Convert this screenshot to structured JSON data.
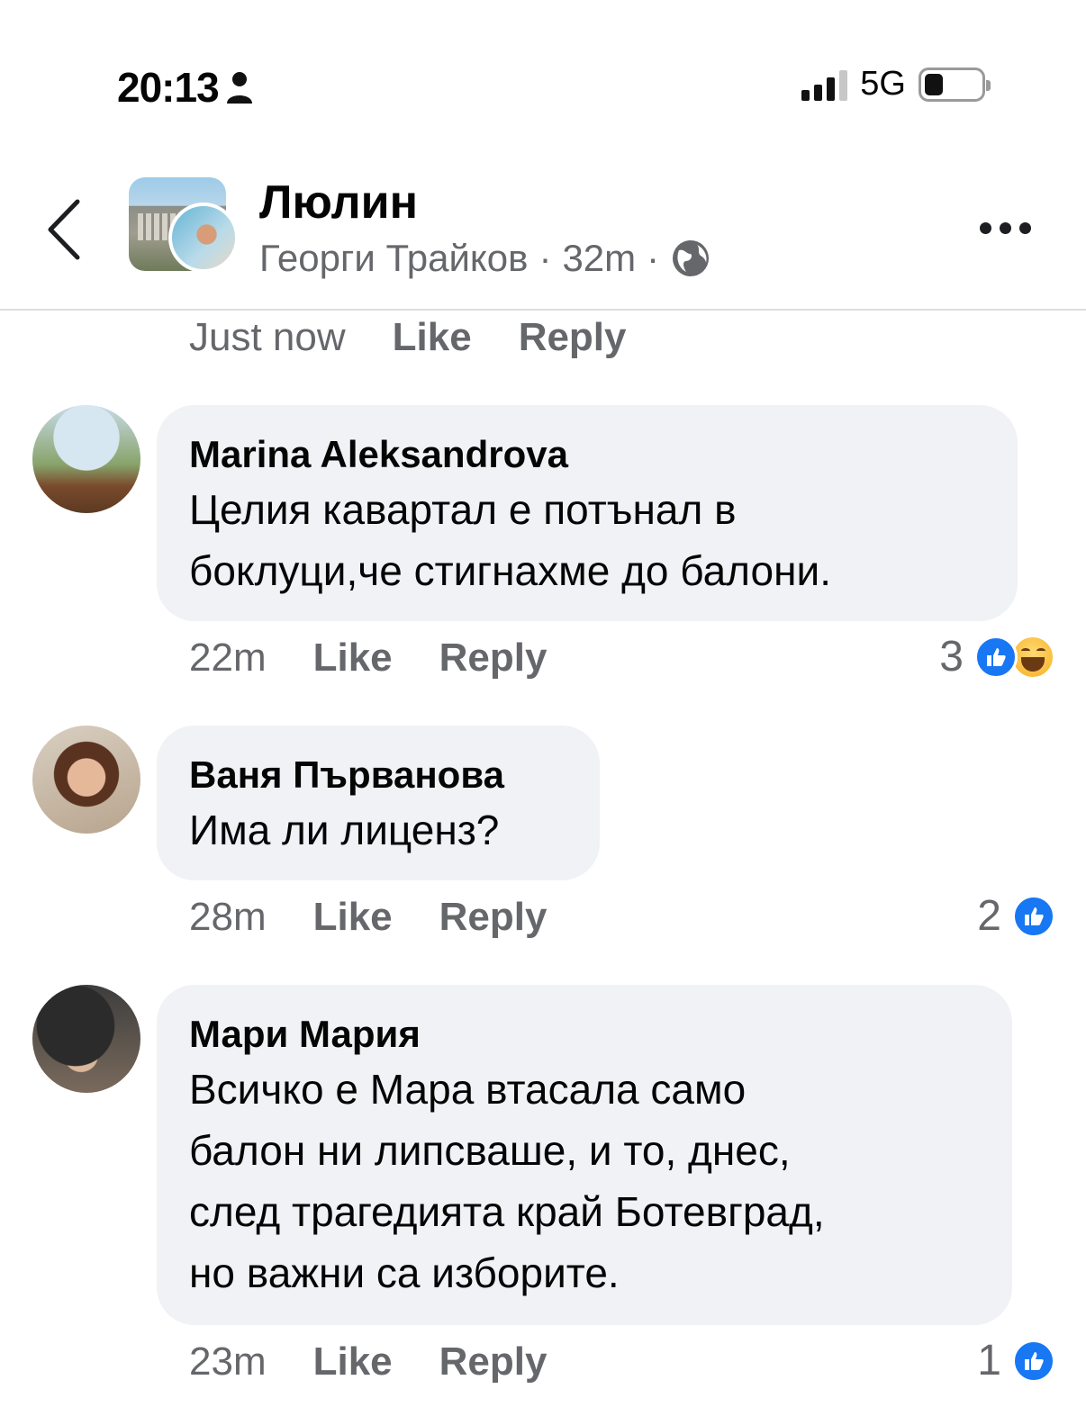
{
  "status_bar": {
    "time": "20:13",
    "network": "5G"
  },
  "header": {
    "group_name": "Люлин",
    "author": "Георги Трайков",
    "separator": "·",
    "posted": "32m"
  },
  "previous_comment_meta": {
    "time": "Just now",
    "like_label": "Like",
    "reply_label": "Reply"
  },
  "comments": [
    {
      "author": "Marina Aleksandrova",
      "lines": [
        "Целия кавартал е потънал в",
        "боклуци,че стигнахме до балони."
      ],
      "time": "22m",
      "like_label": "Like",
      "reply_label": "Reply",
      "reaction_count": "3",
      "reactions": [
        "like",
        "haha"
      ]
    },
    {
      "author": "Ваня Първанова",
      "lines": [
        "Има ли лиценз?"
      ],
      "time": "28m",
      "like_label": "Like",
      "reply_label": "Reply",
      "reaction_count": "2",
      "reactions": [
        "like"
      ]
    },
    {
      "author": "Мари Мария",
      "lines": [
        "Всичко е Мара втасала само",
        "балон ни липсваше, и то, днес,",
        "след трагедията край Ботевград,",
        "но важни са изборите."
      ],
      "time": "23m",
      "like_label": "Like",
      "reply_label": "Reply",
      "reaction_count": "1",
      "reactions": [
        "like"
      ]
    }
  ],
  "colors": {
    "bubble": "#f0f2f5",
    "secondary_text": "#65676b",
    "like_blue": "#1877f2"
  }
}
